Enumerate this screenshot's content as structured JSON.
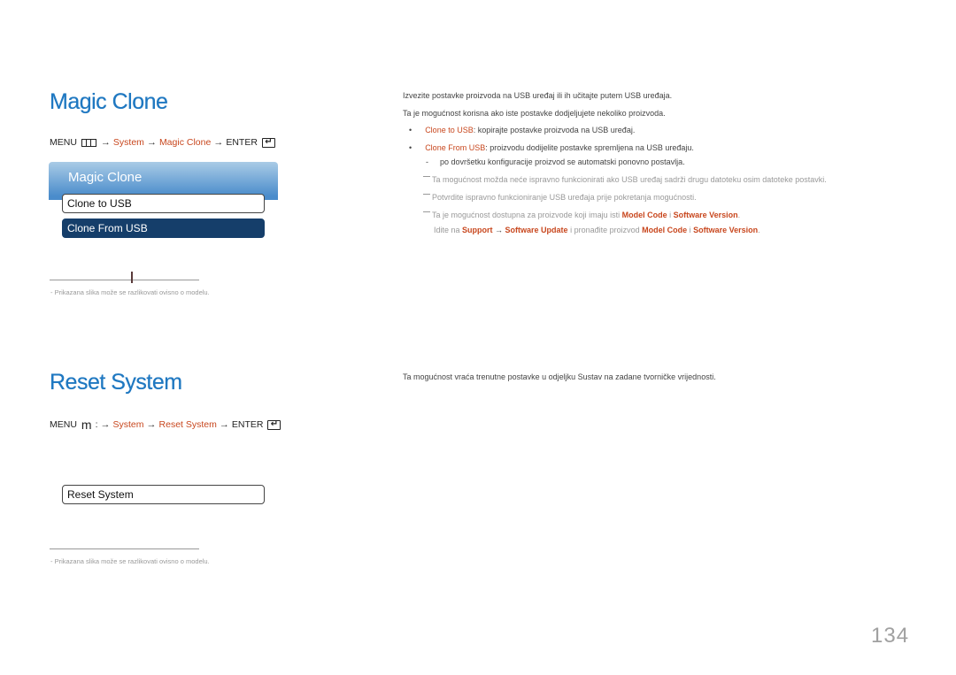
{
  "sections": {
    "magic_clone": {
      "title": "Magic Clone",
      "menu_path": {
        "menu": "MENU",
        "menu_icon": "menu-grid-icon",
        "arrow": "→",
        "step1": "System",
        "step2": "Magic Clone",
        "enter": "ENTER",
        "enter_icon": "enter-icon"
      },
      "osd": {
        "header": "Magic Clone",
        "items": [
          "Clone to USB",
          "Clone From USB"
        ],
        "selected_index": 1
      },
      "footnote": "-   Prikazana slika može se razlikovati ovisno o modelu.",
      "description": {
        "line1": "Izvezite postavke proizvoda na USB uređaj ili ih učitajte putem USB uređaja.",
        "line2": "Ta je mogućnost korisna ako iste postavke dodjeljujete nekoliko proizvoda.",
        "bullets": [
          {
            "label": "Clone to USB",
            "text": ": kopirajte postavke proizvoda na USB uređaj."
          },
          {
            "label": "Clone From USB",
            "text": ": proizvodu dodijelite postavke spremljena na USB uređaju."
          }
        ],
        "sub_bullet": "po dovršetku konfiguracije proizvod se automatski ponovno postavlja.",
        "notes": {
          "note1": "Ta mogućnost možda neće ispravno funkcionirati ako USB uređaj sadrži drugu datoteku osim datoteke postavki.",
          "note2": "Potvrdite ispravno funkcioniranje USB uređaja prije pokretanja mogućnosti.",
          "note3_pre": "Ta je mogućnost dostupna za proizvode koji imaju isti ",
          "note3_model": "Model Code",
          "note3_i": " i ",
          "note3_sw": "Software Version",
          "note3_end": ".",
          "note4_pre": "Idite na ",
          "note4_support": "Support",
          "note4_arrow": " → ",
          "note4_update": "Software Update",
          "note4_mid": " i pronađite proizvod ",
          "note4_model": "Model Code",
          "note4_i": " i ",
          "note4_sw": "Software Version",
          "note4_end": "."
        }
      }
    },
    "reset_system": {
      "title": "Reset System",
      "menu_path": {
        "menu": "MENU",
        "menu_icon": "m",
        "colon": ":",
        "arrow": "→",
        "step1": "System",
        "step2": "Reset System",
        "enter": "ENTER",
        "enter_icon": "enter-icon"
      },
      "osd": {
        "items": [
          "Reset System"
        ]
      },
      "footnote": "-   Prikazana slika može se razlikovati ovisno o modelu.",
      "description": "Ta mogućnost vraća trenutne postavke u odjeljku Sustav na zadane tvorničke vrijednosti."
    }
  },
  "page_number": "134",
  "colors": {
    "heading": "#1f78c1",
    "highlight": "#c8471e",
    "osd_selected": "#153e6a"
  }
}
